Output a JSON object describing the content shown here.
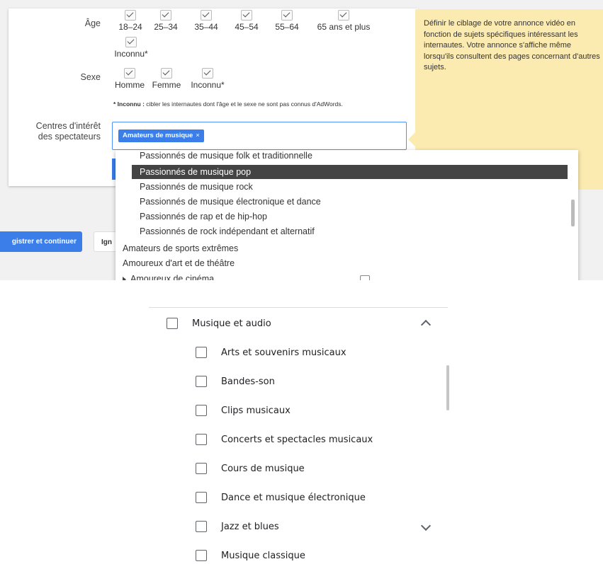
{
  "top": {
    "age_label": "Âge",
    "age_options": [
      "18–24",
      "25–34",
      "35–44",
      "45–54",
      "55–64",
      "65 ans et plus",
      "Inconnu*"
    ],
    "sex_label": "Sexe",
    "sex_options": [
      "Homme",
      "Femme",
      "Inconnu*"
    ],
    "unknown_note_bold": "* Inconnu :",
    "unknown_note": " cibler les internautes dont l'âge et le sexe ne sont pas connus d'AdWords.",
    "interests_label_1": "Centres d'intérêt",
    "interests_label_2": "des spectateurs",
    "selected_chip": "Amateurs de musique",
    "chip_remove": "×",
    "help_text": "Définir le ciblage de votre annonce vidéo en fonction de sujets spécifiques intéressant les internautes. Votre annonce s'affiche même lorsqu'ils consultent des pages concernant d'autres sujets.",
    "save_button": "gistrer et continuer",
    "ignore_button": "Ign",
    "dropdown_items": [
      {
        "label": "Passionnés de musique folk et traditionnelle",
        "level": "sub"
      },
      {
        "label": "Passionnés de musique pop",
        "level": "sub",
        "selected": true
      },
      {
        "label": "Passionnés de musique rock",
        "level": "sub"
      },
      {
        "label": "Passionnés de musique électronique et dance",
        "level": "sub"
      },
      {
        "label": "Passionnés de rap et de hip-hop",
        "level": "sub"
      },
      {
        "label": "Passionnés de rock indépendant et alternatif",
        "level": "sub"
      },
      {
        "label": "Amateurs de sports extrêmes",
        "level": "top"
      },
      {
        "label": "Amoureux d'art et de théâtre",
        "level": "top"
      },
      {
        "label": "Amoureux de cinéma",
        "level": "top",
        "expandable": true
      }
    ]
  },
  "bottom": {
    "parent": {
      "label": "Musique et audio",
      "checked": false,
      "expanded": true
    },
    "children": [
      {
        "label": "Arts et souvenirs musicaux",
        "checked": false
      },
      {
        "label": "Bandes-son",
        "checked": false
      },
      {
        "label": "Clips musicaux",
        "checked": false
      },
      {
        "label": "Concerts et spectacles musicaux",
        "checked": false
      },
      {
        "label": "Cours de musique",
        "checked": false
      },
      {
        "label": "Dance et musique électronique",
        "checked": false
      },
      {
        "label": "Jazz et blues",
        "checked": false,
        "expandable": true
      },
      {
        "label": "Musique classique",
        "checked": false
      }
    ]
  },
  "colors": {
    "accent": "#3b7de9",
    "help_bg": "#fcebb0",
    "selected_row": "#444444"
  }
}
